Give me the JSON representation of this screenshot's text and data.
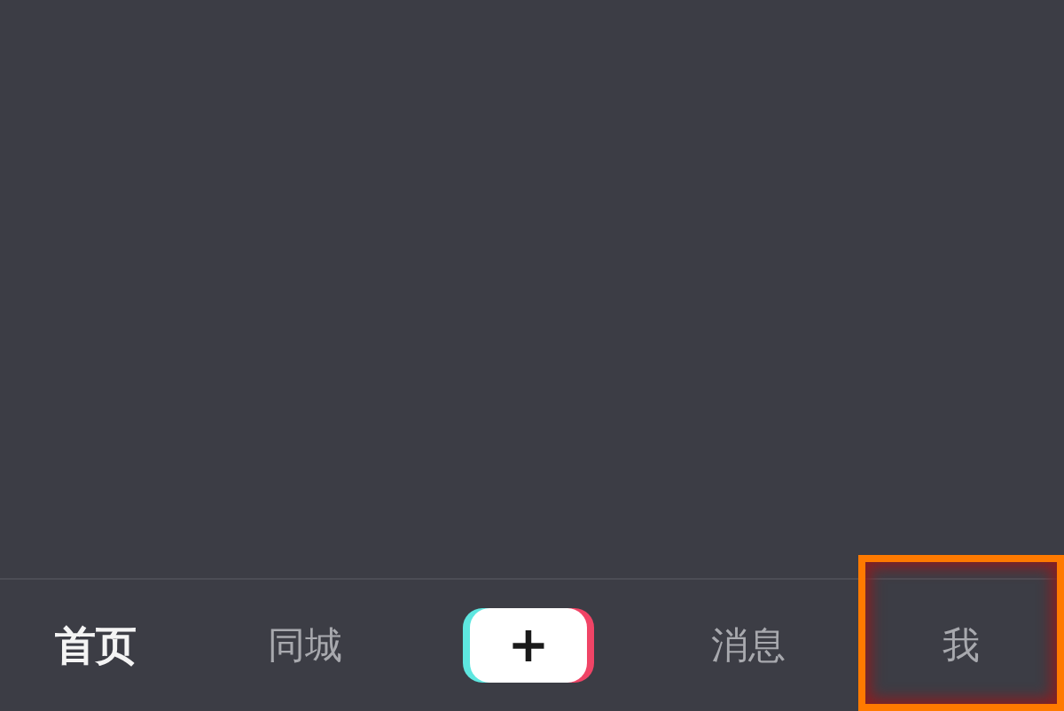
{
  "tab_bar": {
    "items": [
      {
        "kind": "tab",
        "label": "首页",
        "selected": true,
        "highlighted": false
      },
      {
        "kind": "tab",
        "label": "同城",
        "selected": false,
        "highlighted": false
      },
      {
        "kind": "create",
        "label": "+"
      },
      {
        "kind": "tab",
        "label": "消息",
        "selected": false,
        "highlighted": false
      },
      {
        "kind": "tab",
        "label": "我",
        "selected": false,
        "highlighted": true
      }
    ]
  }
}
